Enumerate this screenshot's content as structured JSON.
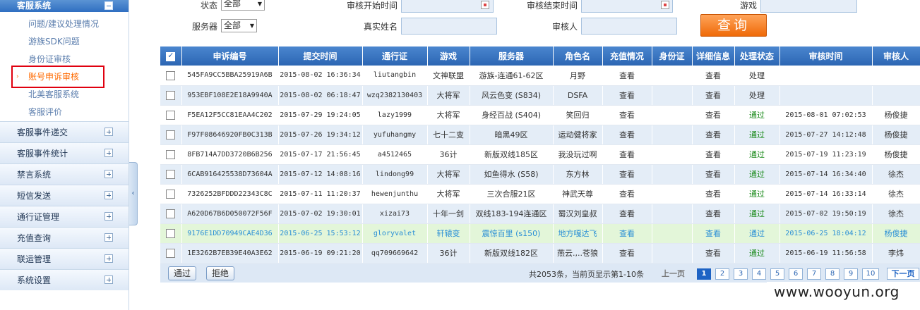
{
  "sidebar": {
    "header": "客服系统",
    "sub_items": [
      {
        "label": "问题/建议处理情况"
      },
      {
        "label": "游族SDK问题"
      },
      {
        "label": "身份证审核"
      },
      {
        "label": "账号申诉审核",
        "active": true
      },
      {
        "label": "北美客服系统"
      },
      {
        "label": "客服评价"
      }
    ],
    "sections": [
      {
        "label": "客服事件递交"
      },
      {
        "label": "客服事件统计"
      },
      {
        "label": "禁言系统"
      },
      {
        "label": "短信发送"
      },
      {
        "label": "通行证管理"
      },
      {
        "label": "充值查询"
      },
      {
        "label": "联运管理"
      },
      {
        "label": "系统设置"
      }
    ],
    "collapse_glyph": "‹"
  },
  "filters": {
    "status_label": "状态",
    "status_value": "全部",
    "audit_start_label": "审核开始时间",
    "audit_end_label": "审核结束时间",
    "game_label": "游戏",
    "server_label": "服务器",
    "server_value": "全部",
    "realname_label": "真实姓名",
    "auditor_label": "审核人",
    "query_button": "查询"
  },
  "table": {
    "headers": [
      "申诉编号",
      "提交时间",
      "通行证",
      "游戏",
      "服务器",
      "角色名",
      "充值情况",
      "身份证",
      "详细信息",
      "处理状态",
      "审核时间",
      "审核人"
    ],
    "rows": [
      {
        "id": "545FA9CC5BBA25919A6B",
        "submit": "2015-08-02 16:36:34",
        "passport": "liutangbin",
        "game": "文神联盟",
        "server": "游族-连通61-62区",
        "role": "月野",
        "recharge": "查看",
        "idcard": "",
        "detail": "查看",
        "status": "处理",
        "audit_time": "",
        "auditor": ""
      },
      {
        "id": "953EBF108E2E18A9940A",
        "submit": "2015-08-02 06:18:47",
        "passport": "wzq2382130403",
        "game": "大将军",
        "server": "风云色变 (S834)",
        "role": "DSFA",
        "recharge": "查看",
        "idcard": "",
        "detail": "查看",
        "status": "处理",
        "audit_time": "",
        "auditor": ""
      },
      {
        "id": "F5EA12F5CC81EAA4C202",
        "submit": "2015-07-29 19:24:05",
        "passport": "lazy1999",
        "game": "大将军",
        "server": "身经百战 (S404)",
        "role": "笑回归",
        "recharge": "查看",
        "idcard": "",
        "detail": "查看",
        "status": "通过",
        "audit_time": "2015-08-01 07:02:53",
        "auditor": "杨俊捷"
      },
      {
        "id": "F97F08646920FB0C313B",
        "submit": "2015-07-26 19:34:12",
        "passport": "yufuhangmy",
        "game": "七十二变",
        "server": "暗黑49区",
        "role": "运动健将家",
        "recharge": "查看",
        "idcard": "",
        "detail": "查看",
        "status": "通过",
        "audit_time": "2015-07-27 14:12:48",
        "auditor": "杨俊捷"
      },
      {
        "id": "8FB714A7DD3720B6B256",
        "submit": "2015-07-17 21:56:45",
        "passport": "a4512465",
        "game": "36计",
        "server": "新版双线185区",
        "role": "我没玩过啊",
        "recharge": "查看",
        "idcard": "",
        "detail": "查看",
        "status": "通过",
        "audit_time": "2015-07-19 11:23:19",
        "auditor": "杨俊捷"
      },
      {
        "id": "6CAB916425538D73604A",
        "submit": "2015-07-12 14:08:16",
        "passport": "lindong99",
        "game": "大将军",
        "server": "如鱼得水 (S58)",
        "role": "东方林",
        "recharge": "查看",
        "idcard": "",
        "detail": "查看",
        "status": "通过",
        "audit_time": "2015-07-14 16:34:40",
        "auditor": "徐杰"
      },
      {
        "id": "7326252BFDDD22343C8C",
        "submit": "2015-07-11 11:20:37",
        "passport": "hewenjunthu",
        "game": "大将军",
        "server": "三次合服21区",
        "role": "神武天尊",
        "recharge": "查看",
        "idcard": "",
        "detail": "查看",
        "status": "通过",
        "audit_time": "2015-07-14 16:33:14",
        "auditor": "徐杰"
      },
      {
        "id": "A620D67B6D050072F56F",
        "submit": "2015-07-02 19:30:01",
        "passport": "xizai73",
        "game": "十年一剑",
        "server": "双线183-194连通区",
        "role": "蜀汉刘皇叔",
        "recharge": "查看",
        "idcard": "",
        "detail": "查看",
        "status": "通过",
        "audit_time": "2015-07-02 19:50:19",
        "auditor": "徐杰"
      },
      {
        "id": "9176E1DD70949CAE4D36",
        "submit": "2015-06-25 15:53:12",
        "passport": "gloryvalet",
        "game": "轩辕变",
        "server": "震惊百里 (s150)",
        "role": "地方嘎达飞",
        "recharge": "查看",
        "idcard": "",
        "detail": "查看",
        "status": "通过",
        "audit_time": "2015-06-25 18:04:12",
        "auditor": "杨俊捷",
        "highlight": true
      },
      {
        "id": "1E3262B7EB39E40A3E62",
        "submit": "2015-06-19 09:21:20",
        "passport": "qq709669642",
        "game": "36计",
        "server": "新版双线182区",
        "role": "燕云.,..苍狼",
        "recharge": "查看",
        "idcard": "",
        "detail": "查看",
        "status": "通过",
        "audit_time": "2015-06-19 11:56:58",
        "auditor": "李炜"
      }
    ]
  },
  "footer": {
    "approve_button": "通过",
    "reject_button": "拒绝",
    "pager_info": "共2053条，当前页显示第1-10条",
    "prev_label": "上一页",
    "pages": [
      "1",
      "2",
      "3",
      "4",
      "5",
      "6",
      "7",
      "8",
      "9",
      "10"
    ],
    "current_page": "1",
    "next_label": "下一页"
  },
  "watermark": "www.wooyun.org",
  "colors": {
    "header_blue": "#2c66b3",
    "accent_orange": "#ef6a08",
    "pass_green": "#1a8a1a",
    "highlight_red": "#e0000f"
  }
}
